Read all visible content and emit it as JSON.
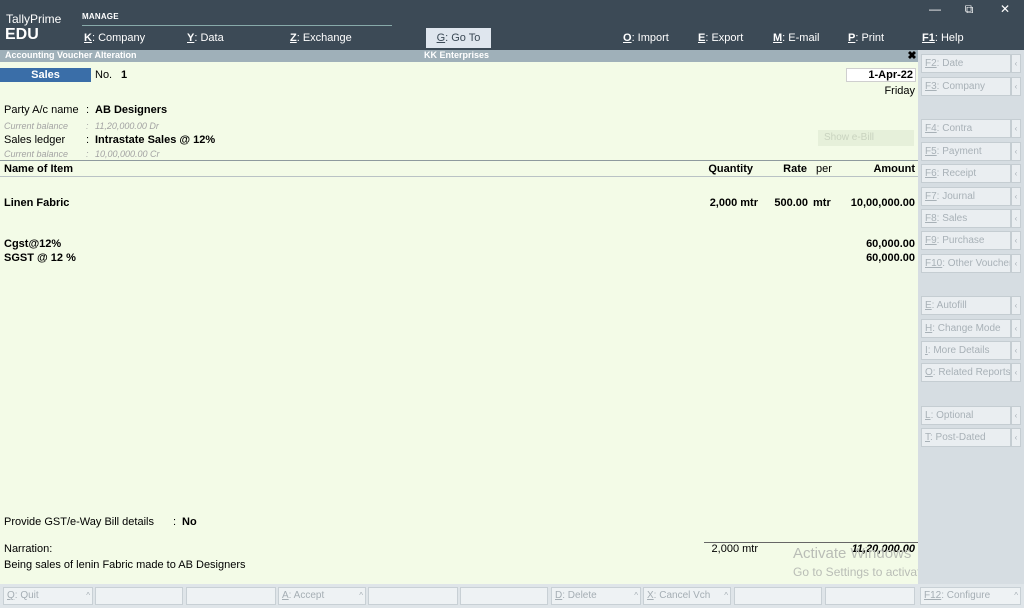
{
  "app": {
    "brand_top": "TallyPrime",
    "brand_bottom": "EDU",
    "section": "MANAGE"
  },
  "menu": [
    {
      "key": "K",
      "label": ": Company"
    },
    {
      "key": "Y",
      "label": ": Data"
    },
    {
      "key": "Z",
      "label": ": Exchange"
    },
    {
      "key": "G",
      "label": ": Go To"
    },
    {
      "key": "O",
      "label": ": Import"
    },
    {
      "key": "E",
      "label": ": Export"
    },
    {
      "key": "M",
      "label": ": E-mail"
    },
    {
      "key": "P",
      "label": ": Print"
    },
    {
      "key": "F1",
      "label": ": Help"
    }
  ],
  "window_controls": {
    "minimize": "—",
    "restore": "⧉",
    "close": "✕"
  },
  "titlebar": {
    "left": "Accounting Voucher Alteration",
    "center": "KK Enterprises",
    "close": "✖"
  },
  "voucher": {
    "type": "Sales",
    "no_label": "No.",
    "no_value": "1",
    "date": "1-Apr-22",
    "day": "Friday",
    "party_label": "Party A/c name",
    "party_value": "AB Designers",
    "party_bal_label": "Current balance",
    "party_bal_value": "11,20,000.00 Dr",
    "ledger_label": "Sales ledger",
    "ledger_value": "Intrastate Sales @ 12%",
    "ledger_bal_label": "Current balance",
    "ledger_bal_value": "10,00,000.00 Cr",
    "faint_button": "Show e-Bill",
    "sep": ":"
  },
  "table": {
    "headers": {
      "item": "Name of Item",
      "qty": "Quantity",
      "rate": "Rate",
      "per": "per",
      "amount": "Amount"
    },
    "item": {
      "name": "Linen Fabric",
      "qty": "2,000 mtr",
      "rate": "500.00",
      "per": "mtr",
      "amount": "10,00,000.00"
    },
    "taxes": [
      {
        "name": "Cgst@12%",
        "amount": "60,000.00"
      },
      {
        "name": "SGST @ 12 %",
        "amount": "60,000.00"
      }
    ]
  },
  "footer": {
    "gst_label": "Provide GST/e-Way Bill details",
    "gst_sep": ":",
    "gst_value": "No",
    "narration_label": "Narration:",
    "narration_text": "Being sales of lenin Fabric made to AB Designers",
    "total_qty": "2,000 mtr",
    "total_amount": "11,20,000.00"
  },
  "watermark": {
    "line1": "Activate Windows",
    "line2": "Go to Settings to activate Windows."
  },
  "right_panel": [
    {
      "key": "F2",
      "label": ": Date"
    },
    {
      "key": "F3",
      "label": ": Company"
    },
    {
      "key": "F4",
      "label": ": Contra"
    },
    {
      "key": "F5",
      "label": ": Payment"
    },
    {
      "key": "F6",
      "label": ": Receipt"
    },
    {
      "key": "F7",
      "label": ": Journal"
    },
    {
      "key": "F8",
      "label": ": Sales"
    },
    {
      "key": "F9",
      "label": ": Purchase"
    },
    {
      "key": "F10",
      "label": ": Other Vouchers"
    },
    {
      "key": "E",
      "label": ": Autofill"
    },
    {
      "key": "H",
      "label": ": Change Mode"
    },
    {
      "key": "I",
      "label": ": More Details"
    },
    {
      "key": "O",
      "label": ": Related Reports"
    },
    {
      "key": "L",
      "label": ": Optional"
    },
    {
      "key": "T",
      "label": ": Post-Dated"
    }
  ],
  "bottom_bar": [
    {
      "key": "Q",
      "label": ": Quit"
    },
    {
      "key": "A",
      "label": ": Accept"
    },
    {
      "key": "D",
      "label": ": Delete"
    },
    {
      "key": "X",
      "label": ": Cancel Vch"
    },
    {
      "key": "F12",
      "label": ": Configure"
    }
  ],
  "arrow_glyph": "‹",
  "bottom_arrow_glyph": "^"
}
